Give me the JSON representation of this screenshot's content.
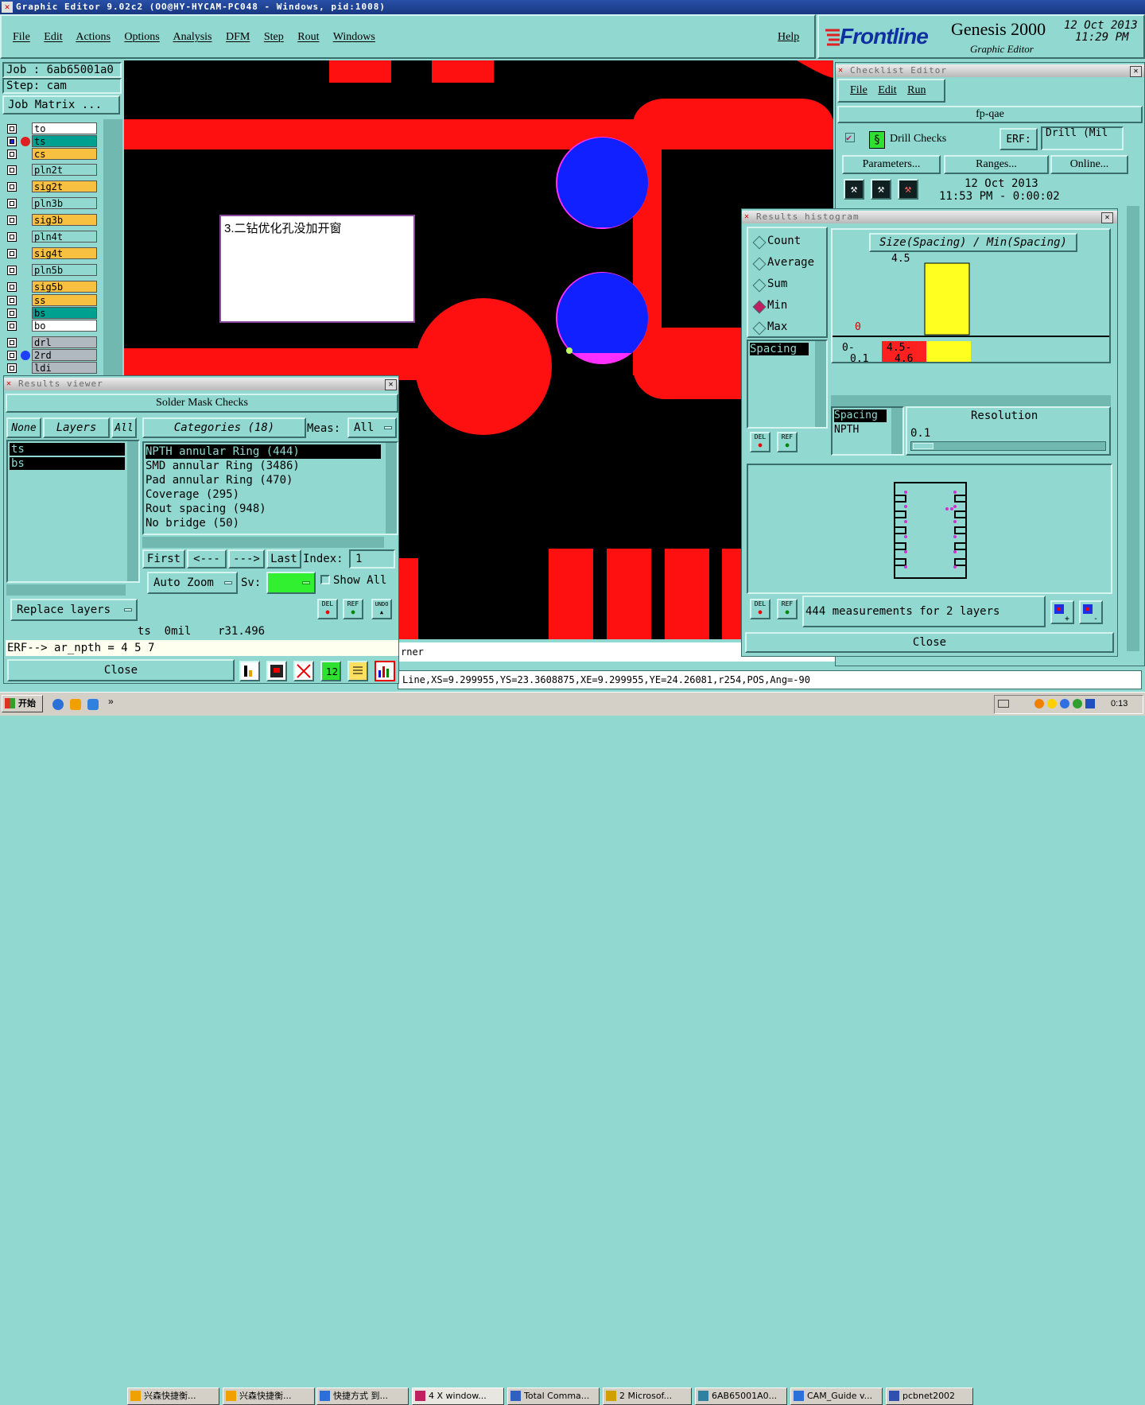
{
  "window": {
    "title": "Graphic Editor 9.02c2  (OO@HY-HYCAM-PC048 - Windows, pid:1008)"
  },
  "menu": {
    "items": [
      "File",
      "Edit",
      "Actions",
      "Options",
      "Analysis",
      "DFM",
      "Step",
      "Rout",
      "Windows"
    ],
    "help": "Help"
  },
  "brand": {
    "logo": "Frontline",
    "product": "Genesis 2000",
    "subtitle": "Graphic Editor",
    "date": "12 Oct 2013",
    "time": "11:29 PM"
  },
  "job": {
    "job_label": "Job : 6ab65001a0",
    "step_label": "Step: cam",
    "matrix_button": "Job Matrix ..."
  },
  "layers": [
    {
      "name": "to",
      "color": "#ffffff"
    },
    {
      "name": "ts",
      "color": "#00a090"
    },
    {
      "name": "cs",
      "color": "#f8c040"
    },
    {
      "name": "pln2t",
      "color": "#90d8d0"
    },
    {
      "name": "sig2t",
      "color": "#f8c040"
    },
    {
      "name": "pln3b",
      "color": "#90d8d0"
    },
    {
      "name": "sig3b",
      "color": "#f8c040"
    },
    {
      "name": "pln4t",
      "color": "#90d8d0"
    },
    {
      "name": "sig4t",
      "color": "#f8c040"
    },
    {
      "name": "pln5b",
      "color": "#90d8d0"
    },
    {
      "name": "sig5b",
      "color": "#f8c040"
    },
    {
      "name": "ss",
      "color": "#f8c040"
    },
    {
      "name": "bs",
      "color": "#00a090"
    },
    {
      "name": "bo",
      "color": "#ffffff"
    },
    {
      "name": "drl",
      "color": "#b0b8c0"
    },
    {
      "name": "2rd",
      "color": "#b0b8c0"
    },
    {
      "name": "ldi",
      "color": "#b0b8c0"
    }
  ],
  "canvas": {
    "annotation": "3.二钻优化孔没加开窗",
    "partial_text": "rner"
  },
  "status_line": "Line,XS=9.299955,YS=23.3608875,XE=9.299955,YE=24.26081,r254,POS,Ang=-90",
  "results_viewer": {
    "title": "Results viewer",
    "header": "Solder Mask Checks",
    "none_label": "None",
    "layers_label": "Layers",
    "all_label": "All",
    "categories_label": "Categories (18)",
    "meas_label": "Meas:",
    "meas_value": "All",
    "layer_items": [
      "ts",
      "bs"
    ],
    "categories": [
      "NPTH annular Ring (444)",
      "SMD annular Ring (3486)",
      "Pad annular Ring (470)",
      "Coverage (295)",
      "Rout spacing (948)",
      "No bridge (50)"
    ],
    "nav": {
      "first": "First",
      "prev": "<---",
      "next": "--->",
      "last": "Last",
      "index_label": "Index:",
      "index_value": "1"
    },
    "auto_zoom": "Auto Zoom",
    "sv_label": "Sv:",
    "show_all": "Show All",
    "replace_layers": "Replace layers",
    "del": "DEL",
    "ref": "REF",
    "undo": "UNDO",
    "info_line": "ts  0mil    r31.496",
    "erf_line": "ERF--> ar_npth = 4 5 7",
    "close": "Close"
  },
  "checklist_editor": {
    "title": "Checklist Editor",
    "menu": [
      "File",
      "Edit",
      "Run"
    ],
    "name": "fp-qae",
    "check_name": "Drill Checks",
    "erf_label": "ERF:",
    "erf_value": "Drill (Mil",
    "parameters": "Parameters...",
    "ranges": "Ranges...",
    "online": "Online...",
    "run_date": "12 Oct 2013",
    "run_time": "11:53 PM - 0:00:02"
  },
  "histogram": {
    "title": "Results histogram",
    "modes": [
      "Count",
      "Average",
      "Sum",
      "Min",
      "Max"
    ],
    "selected_mode": "Min",
    "metric_list": [
      "Spacing"
    ],
    "chart_title": "Size(Spacing) / Min(Spacing)",
    "bins": [
      {
        "label": "0-\n0.1",
        "value": 0,
        "color": "#ff2020"
      },
      {
        "label": "4.5-\n4.6",
        "value": 4.5,
        "color": "#ffff20"
      }
    ],
    "bar_value_label": "4.5",
    "zero_label": "0",
    "bin_label_1": "0-",
    "bin_label_1b": "0.1",
    "bin_label_2": "4.5-",
    "bin_label_2b": "4.6",
    "resolution_label": "Resolution",
    "resolution_value": "0.1",
    "sel_list": [
      "Spacing",
      "NPTH"
    ],
    "measurements": "444 measurements for 2 layers",
    "close": "Close",
    "del": "DEL",
    "ref": "REF"
  },
  "taskbar": {
    "start": "开始",
    "items": [
      "兴森快捷衡...",
      "兴森快捷衡...",
      "快捷方式 到...",
      "4 X window...",
      "Total Comma...",
      "2 Microsof...",
      "6AB65001A0...",
      "CAM_Guide v...",
      "pcbnet2002"
    ],
    "clock": "0:13"
  }
}
